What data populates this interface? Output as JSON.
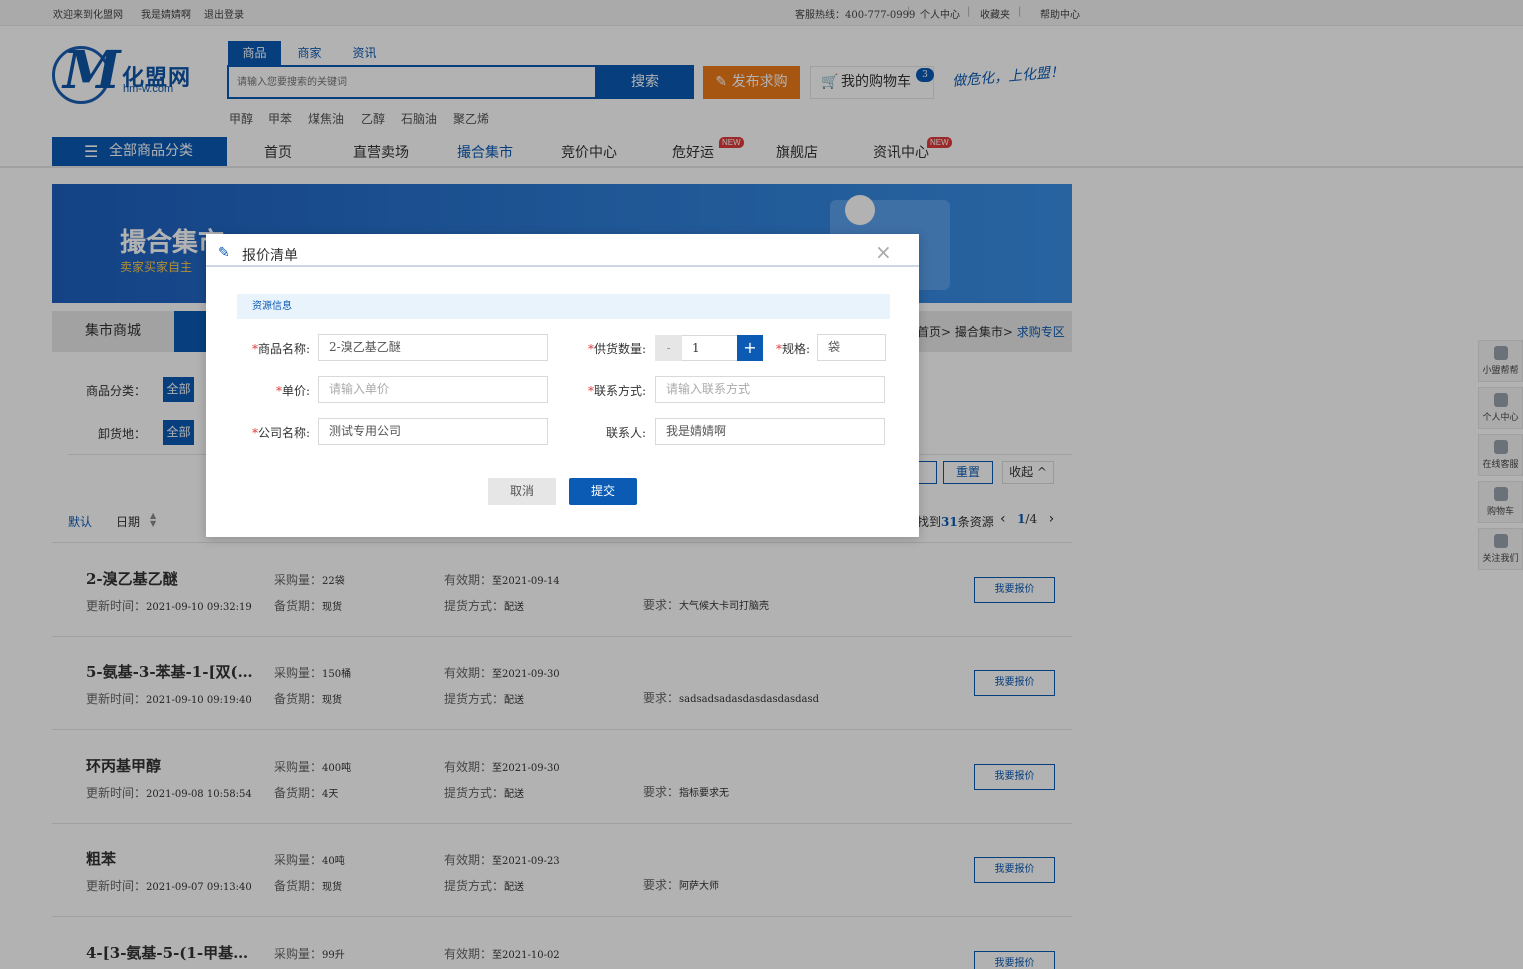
{
  "topbar": {
    "welcome": "欢迎来到化盟网",
    "user": "我是婧婧啊",
    "logout": "退出登录",
    "hotline": "客服热线：400-777-0999",
    "sep": "|",
    "personal": "个人中心",
    "favorites": "收藏夹",
    "help": "帮助中心"
  },
  "logo": {
    "name": "化盟网",
    "domain": "hm-w.com",
    "letter": "M"
  },
  "search": {
    "tabs": [
      "商品",
      "商家",
      "资讯"
    ],
    "placeholder": "请输入您要搜索的关键词",
    "button": "搜索",
    "publish": "发布求购",
    "cart": "我的购物车",
    "cart_count": "3",
    "slogan": "做危化，上化盟！",
    "hot": [
      "甲醇",
      "甲苯",
      "煤焦油",
      "乙醇",
      "石脑油",
      "聚乙烯"
    ]
  },
  "nav": {
    "all_categories": "全部商品分类",
    "items": [
      "首页",
      "直营卖场",
      "撮合集市",
      "竞价中心",
      "危好运",
      "旗舰店",
      "资讯中心"
    ],
    "new_badge": "NEW"
  },
  "banner": {
    "title": "撮合集市",
    "subtitle": "卖家买家自主"
  },
  "section": {
    "tab": "集市商城",
    "breadcrumb_pre": "首页> 撮合集市> ",
    "breadcrumb_current": "求购专区"
  },
  "filter": {
    "category_label": "商品分类：",
    "location_label": "卸货地：",
    "all": "全部",
    "reset": "重置",
    "collapse": "收起 ^"
  },
  "sort": {
    "default": "默认",
    "date": "日期",
    "found_pre": "找到",
    "found_count": "31",
    "found_post": "条资源",
    "page_current": "1",
    "page_total": "/4"
  },
  "labels": {
    "purchase": "采购量：",
    "stock": "备货期：",
    "valid": "有效期：",
    "delivery": "提货方式：",
    "require": "要求：",
    "updated": "更新时间：",
    "quote": "我要报价"
  },
  "rows": [
    {
      "title": "2-溴乙基乙醚",
      "qty": "22袋",
      "updated": "2021-09-10 09:32:19",
      "stock": "现货",
      "valid": "至2021-09-14",
      "delivery": "配送",
      "require": "大气候大卡司打脑壳"
    },
    {
      "title": "5-氨基-3-苯基-1-[双(N...",
      "qty": "150桶",
      "updated": "2021-09-10 09:19:40",
      "stock": "现货",
      "valid": "至2021-09-30",
      "delivery": "配送",
      "require": "sadsadsadasdasdasdasdasd"
    },
    {
      "title": "环丙基甲醇",
      "qty": "400吨",
      "updated": "2021-09-08 10:58:54",
      "stock": "4天",
      "valid": "至2021-09-30",
      "delivery": "配送",
      "require": "指标要求无"
    },
    {
      "title": "粗苯",
      "qty": "40吨",
      "updated": "2021-09-07 09:13:40",
      "stock": "现货",
      "valid": "至2021-09-23",
      "delivery": "配送",
      "require": "阿萨大师"
    },
    {
      "title": "4-[3-氨基-5-(1-甲基胍基...",
      "qty": "99升",
      "updated": "",
      "stock": "",
      "valid": "至2021-10-02",
      "delivery": "",
      "require": ""
    }
  ],
  "sidebar": [
    "小盟帮帮",
    "个人中心",
    "在线客服",
    "购物车",
    "关注我们"
  ],
  "modal": {
    "title": "报价清单",
    "close": "×",
    "section": "资源信息",
    "product_label": "商品名称:",
    "product_value": "2-溴乙基乙醚",
    "supply_label": "供货数量:",
    "supply_value": "1",
    "minus": "-",
    "plus": "+",
    "spec_label": "规格:",
    "spec_value": "袋",
    "price_label": "单价:",
    "price_placeholder": "请输入单价",
    "contact_label": "联系方式:",
    "contact_placeholder": "请输入联系方式",
    "company_label": "公司名称:",
    "company_value": "测试专用公司",
    "person_label": "联系人:",
    "person_value": "我是婧婧啊",
    "cancel": "取消",
    "submit": "提交",
    "required_mark": "*"
  }
}
